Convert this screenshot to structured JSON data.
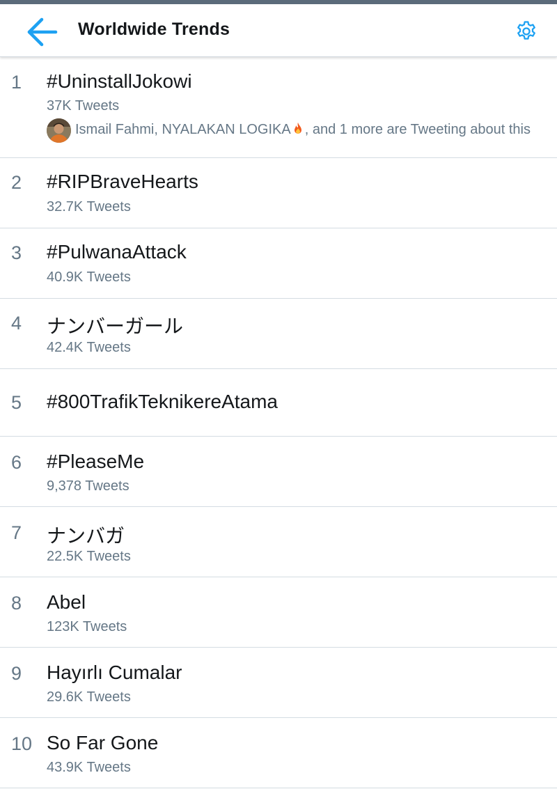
{
  "header": {
    "title": "Worldwide Trends",
    "back_icon": "arrow-left-icon",
    "settings_icon": "gear-icon",
    "accent_color": "#1da1f2"
  },
  "trends": [
    {
      "rank": "1",
      "name": "#UninstallJokowi",
      "count": "37K Tweets",
      "context": {
        "avatar": "user-avatar",
        "people": "Ismail Fahmi, NYALAKAN LOGIKA",
        "emoji": "fire-emoji",
        "suffix": ", and 1 more are Tweeting about this"
      }
    },
    {
      "rank": "2",
      "name": "#RIPBraveHearts",
      "count": "32.7K Tweets"
    },
    {
      "rank": "3",
      "name": "#PulwanaAttack",
      "count": "40.9K Tweets"
    },
    {
      "rank": "4",
      "name": "ナンバーガール",
      "count": "42.4K Tweets"
    },
    {
      "rank": "5",
      "name": "#800TrafikTeknikereAtama"
    },
    {
      "rank": "6",
      "name": "#PleaseMe",
      "count": "9,378 Tweets"
    },
    {
      "rank": "7",
      "name": "ナンバガ",
      "count": "22.5K Tweets"
    },
    {
      "rank": "8",
      "name": "Abel",
      "count": "123K Tweets"
    },
    {
      "rank": "9",
      "name": "Hayırlı Cumalar",
      "count": "29.6K Tweets"
    },
    {
      "rank": "10",
      "name": "So Far Gone",
      "count": "43.9K Tweets"
    }
  ]
}
